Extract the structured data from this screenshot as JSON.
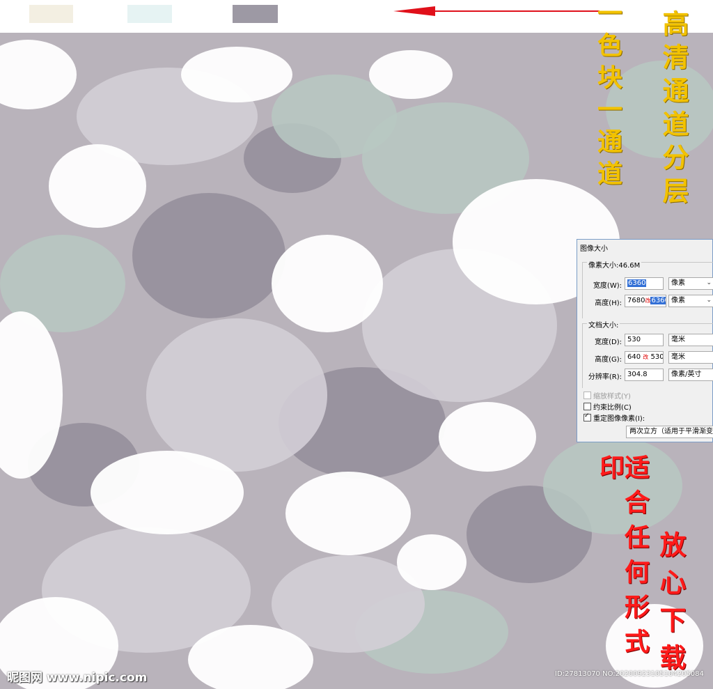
{
  "swatches": [
    {
      "name": "cream",
      "color": "#f3efe2"
    },
    {
      "name": "pale-cyan",
      "color": "#e6f3f3"
    },
    {
      "name": "grey-violet",
      "color": "#9d99a4"
    }
  ],
  "arrow_color": "#e0101a",
  "print_colors": {
    "base": "#b9b3bb",
    "shadow": "#8f8895",
    "mint": "#b7c8c2",
    "light": "#ffffff",
    "mid": "#d3ced6"
  },
  "captions": {
    "channel": "一色块一通道",
    "layers": "高清通道分层",
    "suitable": "适合任何形式印",
    "download": "放心下载",
    "channel_color": "#f2c200",
    "download_color": "#ff1a1a"
  },
  "dialog": {
    "title": "图像大小",
    "pixel_size_label": "像素大小:46.6M",
    "width_label": "宽度(W):",
    "width_value": "6360",
    "width_unit": "像素",
    "height_label": "高度(H):",
    "height_old": "7680",
    "height_new": "6360",
    "height_unit": "像素",
    "doc_size_label": "文档大小:",
    "doc_width_label": "宽度(D):",
    "doc_width_value": "530",
    "doc_width_unit": "毫米",
    "doc_height_label": "高度(G):",
    "doc_height_old": "640",
    "doc_height_new": "530",
    "doc_height_unit": "毫米",
    "resolution_label": "分辨率(R):",
    "resolution_value": "304.8",
    "resolution_unit": "像素/英寸",
    "scale_styles_label": "缩放样式(Y)",
    "constrain_label": "约束比例(C)",
    "resample_label": "重定图像像素(I):",
    "resample_method": "两次立方（适用于平滑渐变",
    "change_mark": "改"
  },
  "watermark": {
    "site": "昵图网 www.nipic.com",
    "id_text": "ID:27813070 NO:20200923105104205084"
  }
}
